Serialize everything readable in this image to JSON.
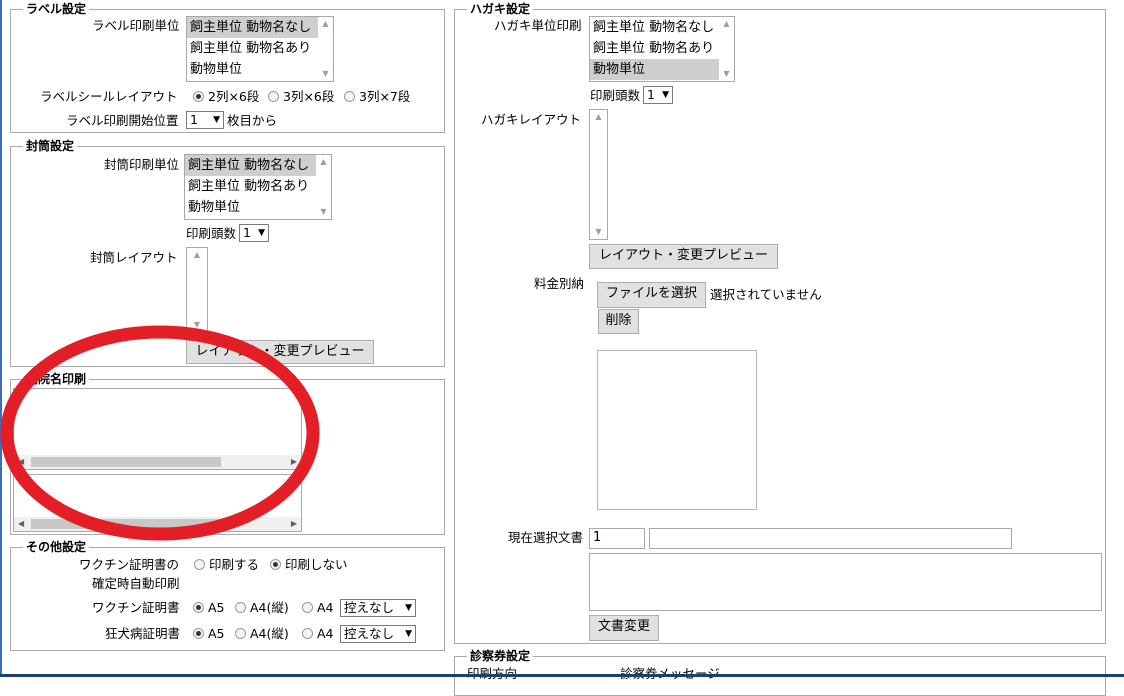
{
  "label_section": {
    "legend": "ラベル設定",
    "print_unit_label": "ラベル印刷単位",
    "print_unit_options": [
      "飼主単位 動物名なし",
      "飼主単位 動物名あり",
      "動物単位"
    ],
    "layout_label": "ラベルシールレイアウト",
    "layout_options": [
      "2列×6段",
      "3列×6段",
      "3列×7段"
    ],
    "start_label": "ラベル印刷開始位置",
    "start_value": "1",
    "start_suffix": "枚目から"
  },
  "envelope_section": {
    "legend": "封筒設定",
    "print_unit_label": "封筒印刷単位",
    "print_unit_options": [
      "飼主単位 動物名なし",
      "飼主単位 動物名あり",
      "動物単位"
    ],
    "count_label": "印刷頭数",
    "count_value": "1",
    "layout_label": "封筒レイアウト",
    "preview_button": "レイアウト・変更プレビュー"
  },
  "hospital_section": {
    "legend": "病院名印刷"
  },
  "other_section": {
    "legend": "その他設定",
    "vaccine_auto_label_1": "ワクチン証明書の",
    "vaccine_auto_label_2": "確定時自動印刷",
    "vaccine_auto_options": [
      "印刷する",
      "印刷しない"
    ],
    "vaccine_cert_label": "ワクチン証明書",
    "rabies_cert_label": "狂犬病証明書",
    "paper_options": [
      "A5",
      "A4(縦)",
      "A4"
    ],
    "copy_value": "控えなし"
  },
  "postcard_section": {
    "legend": "ハガキ設定",
    "print_unit_label": "ハガキ単位印刷",
    "print_unit_options": [
      "飼主単位 動物名なし",
      "飼主単位 動物名あり",
      "動物単位"
    ],
    "count_label": "印刷頭数",
    "count_value": "1",
    "layout_label": "ハガキレイアウト",
    "preview_button": "レイアウト・変更プレビュー",
    "postage_label": "料金別納",
    "file_button": "ファイルを選択",
    "file_status": "選択されていません",
    "delete_button": "削除",
    "current_doc_label": "現在選択文書",
    "current_doc_value": "1",
    "change_doc_button": "文書変更"
  },
  "exam_section": {
    "legend": "診察券設定",
    "print_direction_label": "印刷方向",
    "message_label": "診察券メッセージ"
  },
  "colors": {
    "annotation_circle": "#e41e26",
    "selected_option_bg": "#cfcfcf"
  }
}
